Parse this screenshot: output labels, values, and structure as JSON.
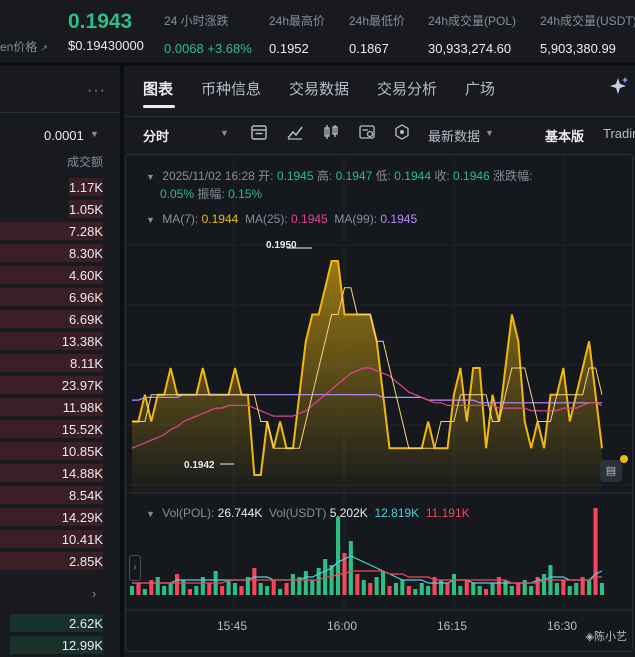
{
  "ticker": {
    "price": "0.1943",
    "usd_label": "en价格",
    "usd_price": "$0.19430000",
    "stats": [
      {
        "label": "24 小时涨跌",
        "value": "0.0068 +3.68%"
      },
      {
        "label": "24h最高价",
        "value": "0.1952"
      },
      {
        "label": "24h最低价",
        "value": "0.1867"
      },
      {
        "label": "24h成交量(POL)",
        "value": "30,933,274.60"
      },
      {
        "label": "24h成交量(USDT)",
        "value": "5,903,380.99"
      }
    ]
  },
  "orderbook": {
    "more": "···",
    "tick_size": "0.0001",
    "column_header": "成交额",
    "asks": [
      {
        "amount": "1.17K",
        "depth": 0.33
      },
      {
        "amount": "1.05K",
        "depth": 0.33
      },
      {
        "amount": "7.28K",
        "depth": 1.0
      },
      {
        "amount": "8.30K",
        "depth": 1.0
      },
      {
        "amount": "4.60K",
        "depth": 1.0
      },
      {
        "amount": "6.96K",
        "depth": 1.0
      },
      {
        "amount": "6.69K",
        "depth": 1.0
      },
      {
        "amount": "13.38K",
        "depth": 1.0
      },
      {
        "amount": "8.11K",
        "depth": 1.0
      },
      {
        "amount": "23.97K",
        "depth": 1.0
      },
      {
        "amount": "11.98K",
        "depth": 1.0
      },
      {
        "amount": "15.52K",
        "depth": 1.0
      },
      {
        "amount": "10.85K",
        "depth": 1.0
      },
      {
        "amount": "14.88K",
        "depth": 1.0
      },
      {
        "amount": "8.54K",
        "depth": 1.0
      },
      {
        "amount": "14.29K",
        "depth": 1.0
      },
      {
        "amount": "10.41K",
        "depth": 1.0
      },
      {
        "amount": "2.85K",
        "depth": 1.0
      }
    ],
    "bids": [
      {
        "amount": "2.62K",
        "depth": 0.9
      },
      {
        "amount": "12.99K",
        "depth": 0.9
      }
    ]
  },
  "tabs": [
    "图表",
    "币种信息",
    "交易数据",
    "交易分析",
    "广场"
  ],
  "toolbar": {
    "interval": "分时",
    "latest_data": "最新数据",
    "basic": "基本版",
    "tradingview": "Tradin"
  },
  "candle_info": {
    "datetime": "2025/11/02 16:28",
    "open_label": "开:",
    "open": "0.1945",
    "high_label": "高:",
    "high": "0.1947",
    "low_label": "低:",
    "low": "0.1944",
    "close_label": "收:",
    "close": "0.1946",
    "change_label": "涨跌幅:",
    "change": "0.05%",
    "amplitude_label": "振幅:",
    "amplitude": "0.15%"
  },
  "ma_info": {
    "ma7_label": "MA(7):",
    "ma7": "0.1944",
    "ma25_label": "MA(25):",
    "ma25": "0.1945",
    "ma99_label": "MA(99):",
    "ma99": "0.1945"
  },
  "vol_info": {
    "pol_label": "Vol(POL):",
    "pol": "26.744K",
    "usdt_label": "Vol(USDT)",
    "usdt": "5.202K",
    "ma_a": "12.819K",
    "ma_b": "11.191K"
  },
  "high_marker": "0.1950",
  "low_marker": "0.1942",
  "colors": {
    "up": "#2ebd85",
    "down": "#f6465d",
    "accent": "#f0b90b",
    "ma25": "#e04695",
    "ma99": "#b78dff",
    "vol_ma_a": "#4fd1e0"
  },
  "chart_data": {
    "type": "area",
    "x_tick_labels": [
      "15:45",
      "16:00",
      "16:15",
      "16:30"
    ],
    "ylim": [
      0.19414,
      0.19506
    ],
    "price": [
      0.1944,
      0.1944,
      0.1945,
      0.1944,
      0.1945,
      0.1945,
      0.1946,
      0.1945,
      0.1945,
      0.1945,
      0.1945,
      0.1946,
      0.1945,
      0.1945,
      0.1945,
      0.1945,
      0.1946,
      0.1945,
      0.1945,
      0.1942,
      0.1942,
      0.1944,
      0.1943,
      0.1944,
      0.1943,
      0.1943,
      0.1945,
      0.1947,
      0.1948,
      0.1948,
      0.1949,
      0.195,
      0.195,
      0.1948,
      0.1948,
      0.1948,
      0.1948,
      0.1948,
      0.1947,
      0.1945,
      0.1943,
      0.1943,
      0.1943,
      0.1943,
      0.1943,
      0.1943,
      0.1944,
      0.1943,
      0.1943,
      0.1943,
      0.1945,
      0.1946,
      0.1944,
      0.1946,
      0.1946,
      0.1943,
      0.1945,
      0.1944,
      0.1946,
      0.1948,
      0.1947,
      0.1944,
      0.1943,
      0.1944,
      0.1943,
      0.1945,
      0.1945,
      0.1946,
      0.1944,
      0.1945,
      0.1946,
      0.1947,
      0.1945,
      0.1943
    ],
    "ma7": [
      0.1944,
      0.1944,
      0.1944,
      0.1945,
      0.1945,
      0.1945,
      0.1945,
      0.1945,
      0.1945,
      0.1945,
      0.1945,
      0.1945,
      0.1945,
      0.1945,
      0.1945,
      0.1945,
      0.1945,
      0.1945,
      0.1945,
      0.1945,
      0.1944,
      0.1944,
      0.1943,
      0.1943,
      0.1943,
      0.1943,
      0.1943,
      0.1944,
      0.1945,
      0.1946,
      0.1947,
      0.1948,
      0.1948,
      0.1949,
      0.1949,
      0.1948,
      0.1948,
      0.1948,
      0.1947,
      0.1947,
      0.1946,
      0.1945,
      0.1944,
      0.1943,
      0.1943,
      0.1943,
      0.1943,
      0.1943,
      0.1944,
      0.1944,
      0.1944,
      0.1945,
      0.1945,
      0.1945,
      0.1945,
      0.1945,
      0.1944,
      0.1944,
      0.1945,
      0.1946,
      0.1946,
      0.1946,
      0.1945,
      0.1944,
      0.1944,
      0.1944,
      0.1945,
      0.1945,
      0.1945,
      0.1945,
      0.1945,
      0.1946,
      0.1946,
      0.1945
    ],
    "ma25": [
      0.1943,
      0.19431,
      0.19432,
      0.19433,
      0.19434,
      0.19435,
      0.19437,
      0.19438,
      0.1944,
      0.19441,
      0.19442,
      0.19443,
      0.19444,
      0.19445,
      0.19445,
      0.19446,
      0.19446,
      0.19446,
      0.19446,
      0.19445,
      0.19444,
      0.19443,
      0.19442,
      0.19442,
      0.19442,
      0.19442,
      0.19443,
      0.19444,
      0.19446,
      0.19448,
      0.1945,
      0.19452,
      0.19454,
      0.19456,
      0.19458,
      0.19459,
      0.1946,
      0.1946,
      0.19459,
      0.19458,
      0.19457,
      0.19455,
      0.19453,
      0.19451,
      0.1945,
      0.19449,
      0.19448,
      0.19447,
      0.19447,
      0.19446,
      0.19446,
      0.19446,
      0.19446,
      0.19446,
      0.19446,
      0.19446,
      0.19446,
      0.19445,
      0.19445,
      0.19445,
      0.19445,
      0.19445,
      0.19444,
      0.19444,
      0.19444,
      0.19444,
      0.19444,
      0.19445,
      0.19445,
      0.19445,
      0.19446,
      0.19447,
      0.19447,
      0.19446
    ],
    "ma99": [
      0.19448,
      0.19448,
      0.19449,
      0.19449,
      0.19449,
      0.19449,
      0.19449,
      0.19449,
      0.1945,
      0.1945,
      0.1945,
      0.1945,
      0.1945,
      0.1945,
      0.1945,
      0.1945,
      0.1945,
      0.1945,
      0.1945,
      0.1945,
      0.1945,
      0.1945,
      0.1945,
      0.1945,
      0.1945,
      0.1945,
      0.1945,
      0.1945,
      0.1945,
      0.1945,
      0.1945,
      0.1945,
      0.1945,
      0.1945,
      0.1945,
      0.1945,
      0.1945,
      0.1945,
      0.1945,
      0.19449,
      0.19449,
      0.19449,
      0.19449,
      0.19449,
      0.19449,
      0.19449,
      0.19448,
      0.19448,
      0.19448,
      0.19448,
      0.19448,
      0.19448,
      0.19448,
      0.19448,
      0.19447,
      0.19447,
      0.19447,
      0.19447,
      0.19447,
      0.19447,
      0.19447,
      0.19447,
      0.19447,
      0.19447,
      0.19447,
      0.19447,
      0.19447,
      0.19447,
      0.19447,
      0.19447,
      0.19447,
      0.19447,
      0.19447,
      0.19447
    ],
    "volume": [
      3,
      4,
      2,
      5,
      6,
      3,
      4,
      7,
      5,
      2,
      3,
      6,
      4,
      8,
      3,
      5,
      4,
      3,
      6,
      9,
      4,
      3,
      5,
      2,
      4,
      7,
      6,
      8,
      5,
      9,
      12,
      10,
      26,
      14,
      18,
      7,
      5,
      4,
      6,
      8,
      3,
      4,
      5,
      3,
      2,
      4,
      3,
      6,
      5,
      4,
      7,
      3,
      5,
      4,
      3,
      2,
      4,
      6,
      5,
      3,
      4,
      5,
      3,
      6,
      7,
      10,
      4,
      5,
      3,
      4,
      6,
      5,
      29,
      4
    ],
    "volume_up": [
      1,
      0,
      1,
      0,
      1,
      1,
      1,
      0,
      1,
      0,
      1,
      1,
      0,
      1,
      0,
      1,
      1,
      0,
      1,
      0,
      1,
      1,
      0,
      1,
      0,
      1,
      1,
      1,
      1,
      1,
      1,
      1,
      1,
      0,
      1,
      0,
      1,
      0,
      1,
      1,
      0,
      1,
      1,
      0,
      1,
      1,
      1,
      0,
      1,
      0,
      1,
      1,
      0,
      1,
      1,
      0,
      1,
      0,
      1,
      1,
      0,
      1,
      1,
      0,
      1,
      1,
      1,
      0,
      1,
      1,
      0,
      1,
      0,
      1
    ],
    "vol_ma_a": [
      4,
      4,
      4,
      4,
      4,
      4,
      4,
      5,
      5,
      5,
      5,
      5,
      5,
      5,
      5,
      5,
      5,
      5,
      5,
      6,
      6,
      6,
      5,
      5,
      5,
      5,
      5,
      6,
      6,
      7,
      8,
      9,
      11,
      12,
      13,
      12,
      11,
      10,
      9,
      8,
      7,
      6,
      5,
      5,
      5,
      5,
      4,
      4,
      4,
      4,
      5,
      5,
      5,
      4,
      4,
      4,
      4,
      4,
      4,
      4,
      4,
      4,
      4,
      5,
      5,
      6,
      6,
      6,
      5,
      5,
      5,
      5,
      7,
      8
    ],
    "vol_ma_b": [
      4,
      4,
      4,
      4,
      4,
      4,
      4,
      4,
      4,
      4,
      4,
      4,
      4,
      4,
      4,
      5,
      5,
      5,
      5,
      5,
      5,
      5,
      5,
      5,
      5,
      5,
      5,
      5,
      5,
      5,
      6,
      6,
      7,
      7,
      8,
      8,
      8,
      8,
      8,
      8,
      7,
      7,
      7,
      6,
      6,
      6,
      6,
      5,
      5,
      5,
      5,
      5,
      5,
      5,
      5,
      5,
      5,
      5,
      5,
      4,
      4,
      4,
      4,
      4,
      5,
      5,
      5,
      5,
      5,
      5,
      5,
      5,
      6,
      6
    ]
  },
  "watermark": "◈陈小艺"
}
